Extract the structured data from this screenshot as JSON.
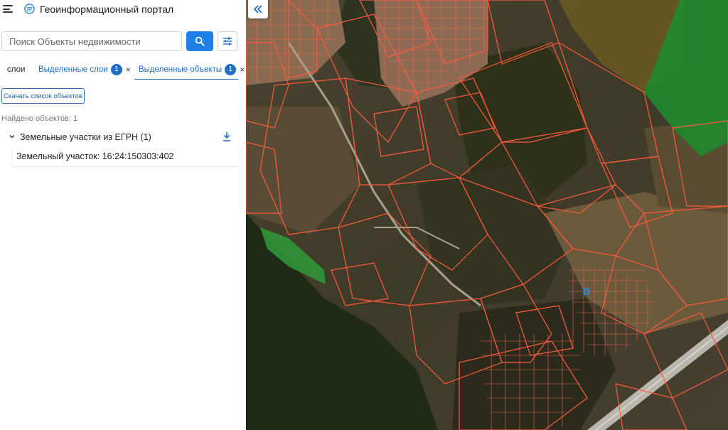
{
  "header": {
    "title": "Геоинформационный портал",
    "menu_icon": "hamburger-icon",
    "logo_icon": "portal-logo-icon"
  },
  "search": {
    "placeholder": "Поиск Объекты недвижимости",
    "value": "",
    "button_icon": "search-icon",
    "filter_icon": "sliders-icon"
  },
  "tabs": [
    {
      "label": "слои",
      "active": false
    },
    {
      "label": "Выделенные слои",
      "badge": "1",
      "active": false
    },
    {
      "label": "Выделенные объекты",
      "badge": "1",
      "active": true
    }
  ],
  "tab_close_glyph": "×",
  "actions": {
    "download_list_label": "Скачать список объектов"
  },
  "results": {
    "found_text": "Найдено объектов: 1",
    "groups": [
      {
        "title": "Земельные участки из ЕГРН (1)",
        "expanded": true,
        "items": [
          {
            "label": "Земельный участок: 16:24:150303:402"
          }
        ]
      }
    ]
  },
  "map": {
    "collapse_icon": "double-chevron-left-icon",
    "parcel_outline_color": "#ff5a3c",
    "marker_letter": "D",
    "marker_color": "#1e90ff"
  },
  "colors": {
    "accent": "#1f7fe6",
    "link": "#1f6fc7"
  }
}
